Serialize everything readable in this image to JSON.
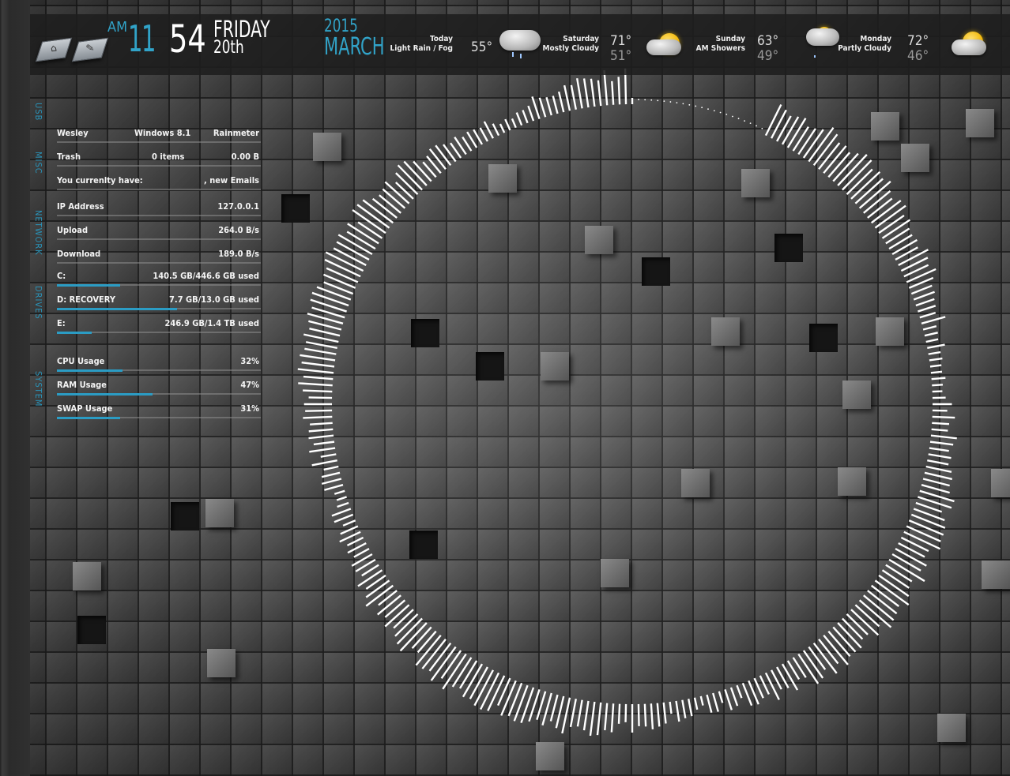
{
  "clock": {
    "ampm": "AM",
    "hour": "11",
    "minute": "54",
    "weekday": "FRIDAY",
    "day": "20th",
    "year": "2015",
    "month": "MARCH"
  },
  "dock": {
    "items": [
      {
        "name": "computer-icon"
      },
      {
        "name": "settings-icon"
      }
    ]
  },
  "weather": [
    {
      "day": "Today",
      "condition": "Light Rain / Fog",
      "high": "55°",
      "low": "",
      "icon": "rain-cloud-icon"
    },
    {
      "day": "Saturday",
      "condition": "Mostly Cloudy",
      "high": "71°",
      "low": "51°",
      "icon": "partly-sunny-icon"
    },
    {
      "day": "Sunday",
      "condition": "AM Showers",
      "high": "63°",
      "low": "49°",
      "icon": "showers-icon"
    },
    {
      "day": "Monday",
      "condition": "Partly Cloudy",
      "high": "72°",
      "low": "46°",
      "icon": "partly-cloudy-icon"
    }
  ],
  "sections": {
    "usb": "USB",
    "misc": "MISC",
    "network": "NETWORK",
    "drives": "DRIVES",
    "system": "SYSTEM"
  },
  "misc": {
    "user": "Wesley",
    "os": "Windows 8.1",
    "app": "Rainmeter",
    "trash_label": "Trash",
    "trash_items": "0 items",
    "trash_size": "0.00 B",
    "email_label": "You currenlty have:",
    "email_value": ", new Emails"
  },
  "network": {
    "ip_label": "IP Address",
    "ip_value": "127.0.0.1",
    "upload_label": "Upload",
    "upload_value": "264.0 B/s",
    "download_label": "Download",
    "download_value": "189.0 B/s"
  },
  "drives": [
    {
      "label": "C:",
      "value": "140.5 GB/446.6 GB used",
      "fraction": 0.31
    },
    {
      "label": "D: RECOVERY",
      "value": "7.7 GB/13.0 GB used",
      "fraction": 0.59
    },
    {
      "label": "E:",
      "value": "246.9 GB/1.4 TB used",
      "fraction": 0.17
    }
  ],
  "system": [
    {
      "label": "CPU Usage",
      "value": "32%",
      "fraction": 0.32
    },
    {
      "label": "RAM Usage",
      "value": "47%",
      "fraction": 0.47
    },
    {
      "label": "SWAP Usage",
      "value": "31%",
      "fraction": 0.31
    }
  ],
  "colors": {
    "accent": "#31a3c8",
    "text": "#f2f2f2",
    "visualizer": "#ffffff"
  }
}
